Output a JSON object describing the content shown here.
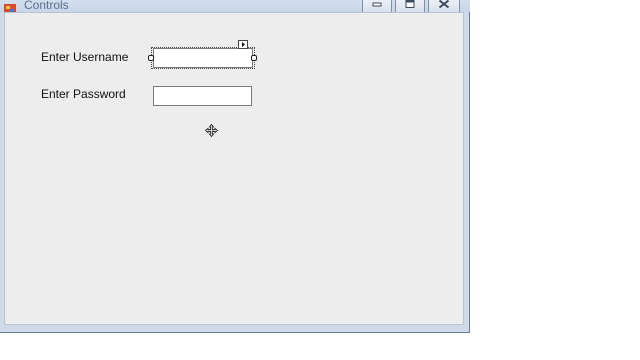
{
  "window": {
    "title": "Controls"
  },
  "form": {
    "username_label": "Enter Username",
    "password_label": "Enter Password",
    "username_value": "",
    "password_value": ""
  },
  "icons": {
    "app": "app-icon",
    "minimize": "minimize-icon",
    "maximize": "maximize-icon",
    "close": "close-icon",
    "smart_tag": "smart-tag-arrow-icon",
    "move_cursor": "move-cursor-icon"
  }
}
